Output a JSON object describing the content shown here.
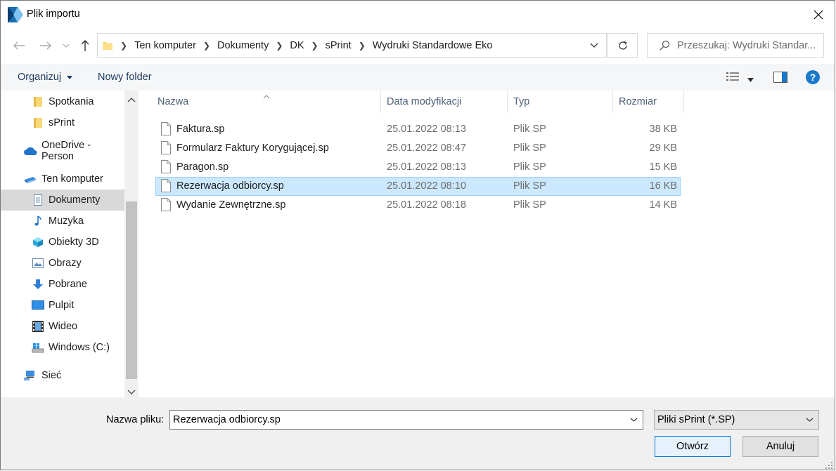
{
  "window": {
    "title": "Plik importu"
  },
  "address": {
    "crumbs": [
      "Ten komputer",
      "Dokumenty",
      "DK",
      "sPrint",
      "Wydruki Standardowe Eko"
    ]
  },
  "search": {
    "placeholder": "Przeszukaj: Wydruki Standar..."
  },
  "toolbar": {
    "organize": "Organizuj",
    "new_folder": "Nowy folder",
    "help": "?"
  },
  "sidebar": {
    "items": [
      {
        "label": "Spotkania",
        "icon": "folder-icon"
      },
      {
        "label": "sPrint",
        "icon": "folder-icon"
      },
      {
        "label": "OneDrive - Person",
        "icon": "cloud-icon"
      },
      {
        "label": "Ten komputer",
        "icon": "computer-icon"
      },
      {
        "label": "Dokumenty",
        "icon": "documents-icon",
        "selected": true
      },
      {
        "label": "Muzyka",
        "icon": "music-icon"
      },
      {
        "label": "Obiekty 3D",
        "icon": "cube-icon"
      },
      {
        "label": "Obrazy",
        "icon": "pictures-icon"
      },
      {
        "label": "Pobrane",
        "icon": "download-icon"
      },
      {
        "label": "Pulpit",
        "icon": "desktop-icon"
      },
      {
        "label": "Wideo",
        "icon": "video-icon"
      },
      {
        "label": "Windows (C:)",
        "icon": "drive-icon"
      },
      {
        "label": "Sieć",
        "icon": "network-icon"
      }
    ]
  },
  "columns": {
    "name": "Nazwa",
    "date": "Data modyfikacji",
    "type": "Typ",
    "size": "Rozmiar"
  },
  "files": [
    {
      "name": "Faktura.sp",
      "date": "25.01.2022 08:13",
      "type": "Plik SP",
      "size": "38 KB"
    },
    {
      "name": "Formularz Faktury Korygującej.sp",
      "date": "25.01.2022 08:47",
      "type": "Plik SP",
      "size": "29 KB"
    },
    {
      "name": "Paragon.sp",
      "date": "25.01.2022 08:13",
      "type": "Plik SP",
      "size": "15 KB"
    },
    {
      "name": "Rezerwacja odbiorcy.sp",
      "date": "25.01.2022 08:10",
      "type": "Plik SP",
      "size": "16 KB",
      "selected": true
    },
    {
      "name": "Wydanie Zewnętrzne.sp",
      "date": "25.01.2022 08:18",
      "type": "Plik SP",
      "size": "14 KB"
    }
  ],
  "bottom": {
    "filename_label": "Nazwa pliku:",
    "filename_value": "Rezerwacja odbiorcy.sp",
    "filetype_value": "Pliki sPrint (*.SP)",
    "open_button": "Otwórz",
    "cancel_button": "Anuluj"
  },
  "colors": {
    "selection": "#cce8ff",
    "selection_border": "#99d1ff",
    "accent": "#0078d7",
    "help": "#1979ca"
  }
}
